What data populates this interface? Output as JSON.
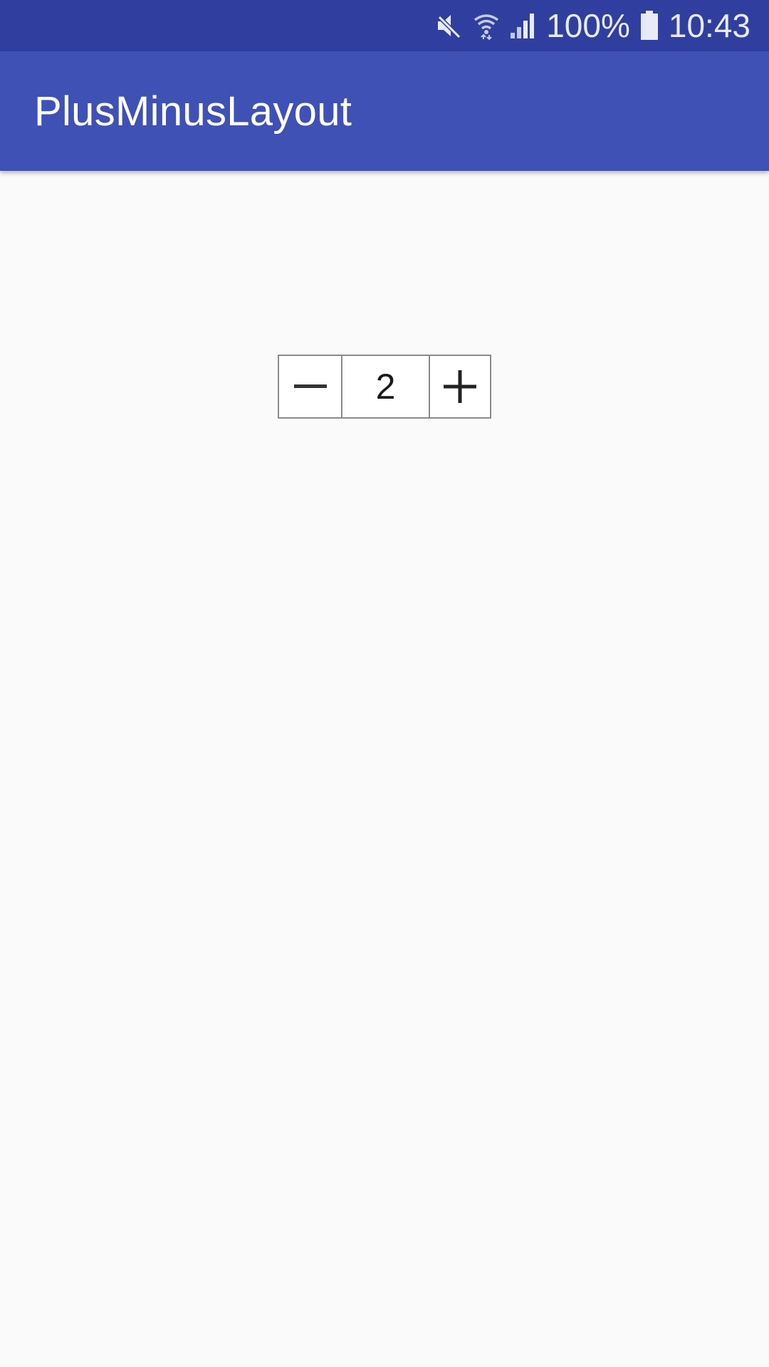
{
  "status_bar": {
    "icons": [
      "mute-icon",
      "wifi-icon",
      "signal-icon",
      "battery-icon"
    ],
    "battery_text": "100%",
    "time": "10:43",
    "background": "#303f9f"
  },
  "app_bar": {
    "title": "PlusMinusLayout",
    "background": "#3f51b5"
  },
  "stepper": {
    "value": "2",
    "minus_icon": "minus-icon",
    "plus_icon": "plus-icon"
  }
}
